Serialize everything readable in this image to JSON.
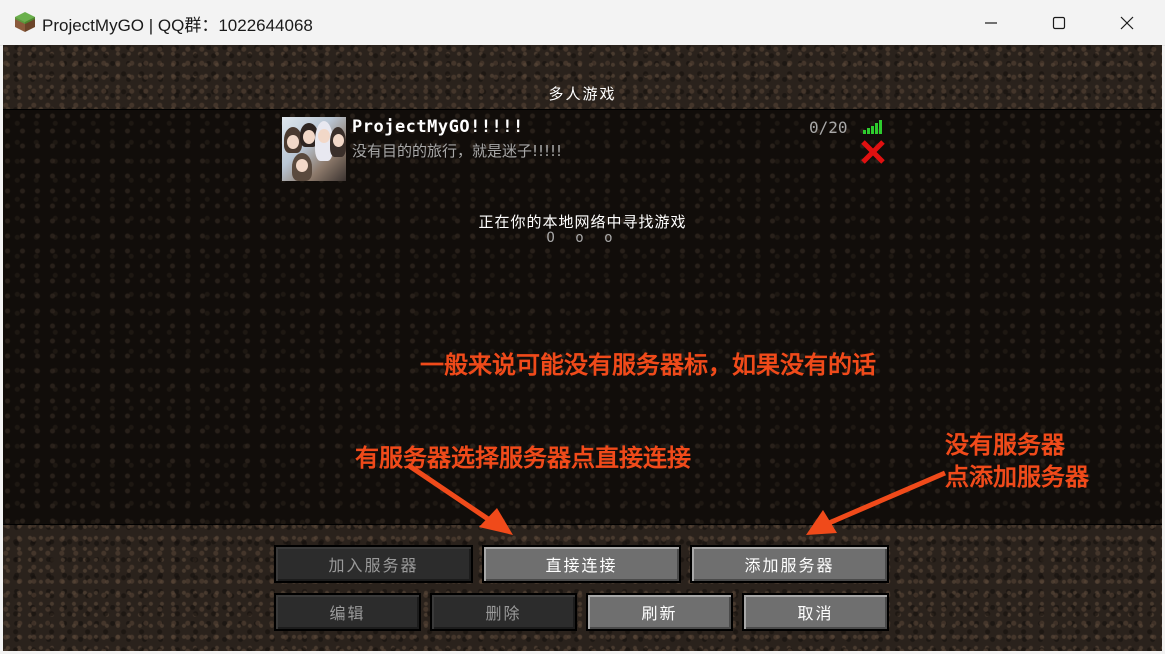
{
  "window": {
    "title": "ProjectMyGO | QQ群：1022644068",
    "icon": "grass-block-icon"
  },
  "screen": {
    "title": "多人游戏"
  },
  "server": {
    "name": "ProjectMyGO!!!!!",
    "motd": "没有目的的旅行，就是迷子!!!!!",
    "players": "0/20",
    "signal_color": "#2ecc2e",
    "remove_color": "#e01010"
  },
  "lan": {
    "scanning_text": "正在你的本地网络中寻找游戏",
    "dots": "O o o"
  },
  "annotations": {
    "line1": "一般来说可能没有服务器标，如果没有的话",
    "line2": "有服务器选择服务器点直接连接",
    "line3a": "没有服务器",
    "line3b": "点添加服务器",
    "color": "#f04a1a"
  },
  "buttons": {
    "join": "加入服务器",
    "direct": "直接连接",
    "add": "添加服务器",
    "edit": "编辑",
    "delete": "删除",
    "refresh": "刷新",
    "cancel": "取消"
  }
}
